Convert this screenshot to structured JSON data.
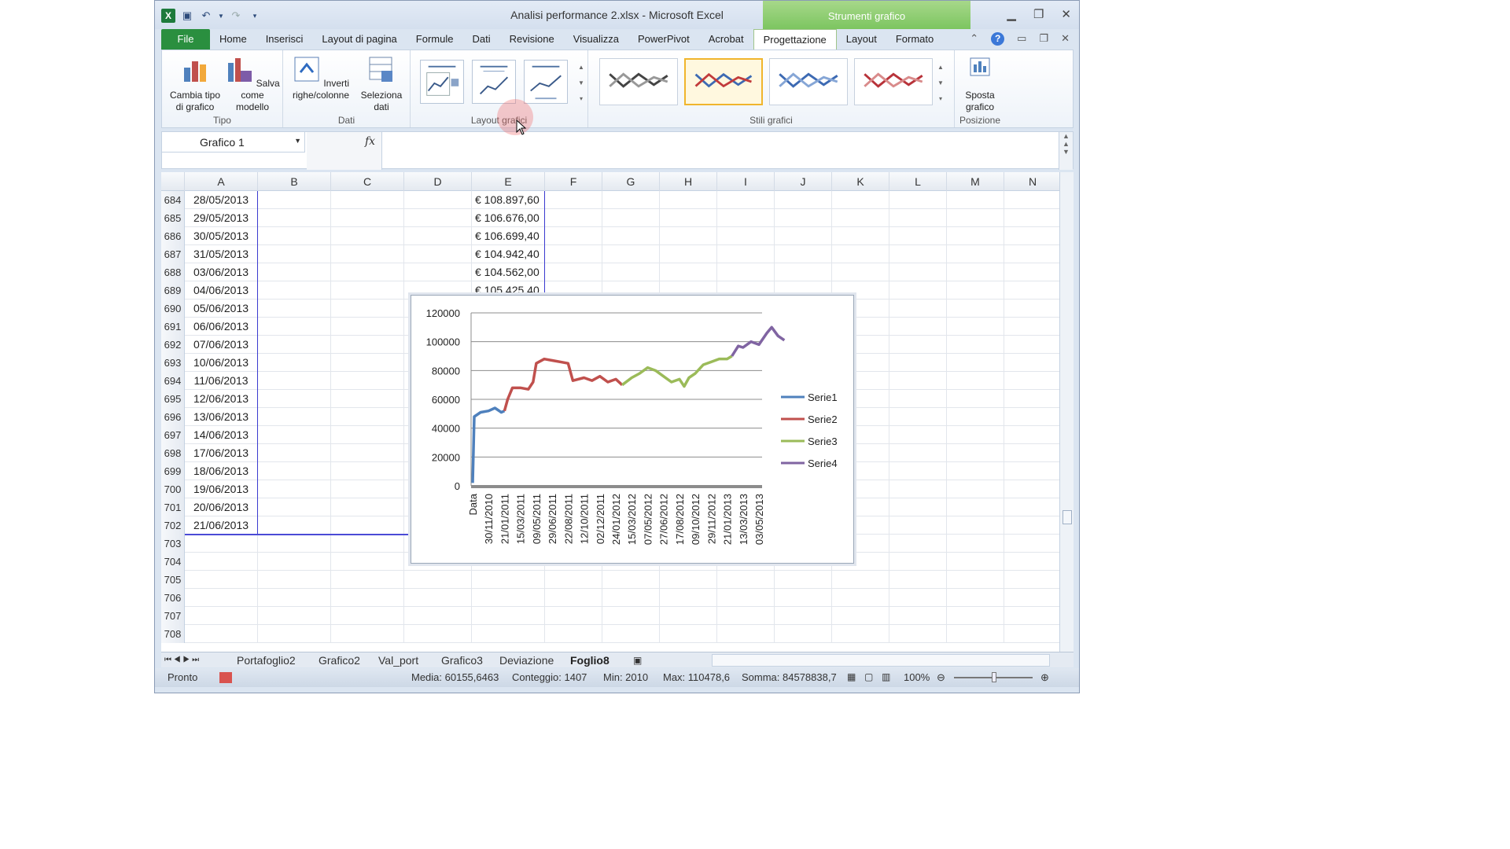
{
  "window": {
    "title": "Analisi performance 2.xlsx - Microsoft Excel",
    "contextual_title": "Strumenti grafico"
  },
  "menu": {
    "tabs": [
      "File",
      "Home",
      "Inserisci",
      "Layout di pagina",
      "Formule",
      "Dati",
      "Revisione",
      "Visualizza",
      "PowerPivot",
      "Acrobat",
      "Progettazione",
      "Layout",
      "Formato"
    ],
    "active": "Progettazione"
  },
  "ribbon": {
    "tipo": {
      "label": "Tipo",
      "change_type": "Cambia tipo di grafico",
      "save_template": "Salva come modello"
    },
    "dati": {
      "label": "Dati",
      "switch": "Inverti righe/colonne",
      "select": "Seleziona dati"
    },
    "layout_label": "Layout grafici",
    "styles_label": "Stili grafici",
    "posizione": {
      "label": "Posizione",
      "move": "Sposta grafico"
    }
  },
  "formula_bar": {
    "name_box": "Grafico 1",
    "fx": "fx"
  },
  "columns": [
    "A",
    "B",
    "C",
    "D",
    "E",
    "F",
    "G",
    "H",
    "I",
    "J",
    "K",
    "L",
    "M",
    "N"
  ],
  "rows": [
    {
      "n": "684",
      "a": "28/05/2013",
      "e": "€ 108.897,60"
    },
    {
      "n": "685",
      "a": "29/05/2013",
      "e": "€ 106.676,00"
    },
    {
      "n": "686",
      "a": "30/05/2013",
      "e": "€ 106.699,40"
    },
    {
      "n": "687",
      "a": "31/05/2013",
      "e": "€ 104.942,40"
    },
    {
      "n": "688",
      "a": "03/06/2013",
      "e": "€ 104.562,00"
    },
    {
      "n": "689",
      "a": "04/06/2013",
      "e": "€ 105.425,40"
    },
    {
      "n": "690",
      "a": "05/06/2013",
      "e": ""
    },
    {
      "n": "691",
      "a": "06/06/2013",
      "e": ""
    },
    {
      "n": "692",
      "a": "07/06/2013",
      "e": ""
    },
    {
      "n": "693",
      "a": "10/06/2013",
      "e": ""
    },
    {
      "n": "694",
      "a": "11/06/2013",
      "e": ""
    },
    {
      "n": "695",
      "a": "12/06/2013",
      "e": ""
    },
    {
      "n": "696",
      "a": "13/06/2013",
      "e": ""
    },
    {
      "n": "697",
      "a": "14/06/2013",
      "e": ""
    },
    {
      "n": "698",
      "a": "17/06/2013",
      "e": ""
    },
    {
      "n": "699",
      "a": "18/06/2013",
      "e": ""
    },
    {
      "n": "700",
      "a": "19/06/2013",
      "e": ""
    },
    {
      "n": "701",
      "a": "20/06/2013",
      "e": ""
    },
    {
      "n": "702",
      "a": "21/06/2013",
      "e": ""
    },
    {
      "n": "703",
      "a": "",
      "e": ""
    },
    {
      "n": "704",
      "a": "",
      "e": ""
    },
    {
      "n": "705",
      "a": "",
      "e": ""
    },
    {
      "n": "706",
      "a": "",
      "e": ""
    },
    {
      "n": "707",
      "a": "",
      "e": ""
    },
    {
      "n": "708",
      "a": "",
      "e": ""
    }
  ],
  "sheet_tabs": [
    "Portafoglio2",
    "Grafico2",
    "Val_port",
    "Grafico3",
    "Deviazione",
    "Foglio8"
  ],
  "active_sheet": "Foglio8",
  "status": {
    "ready": "Pronto",
    "media": "Media: 60155,6463",
    "conteggio": "Conteggio: 1407",
    "min": "Min: 2010",
    "max": "Max: 110478,6",
    "somma": "Somma: 84578838,7",
    "zoom": "100%"
  },
  "chart_data": {
    "type": "line",
    "ylim": [
      0,
      120000
    ],
    "yticks": [
      "0",
      "20000",
      "40000",
      "60000",
      "80000",
      "100000",
      "120000"
    ],
    "xticks": [
      "Data",
      "30/11/2010",
      "21/01/2011",
      "15/03/2011",
      "09/05/2011",
      "29/06/2011",
      "22/08/2011",
      "12/10/2011",
      "02/12/2011",
      "24/01/2012",
      "15/03/2012",
      "07/05/2012",
      "27/06/2012",
      "17/08/2012",
      "09/10/2012",
      "29/11/2012",
      "21/01/2013",
      "13/03/2013",
      "03/05/2013"
    ],
    "series": [
      {
        "name": "Serie1",
        "color": "#4f81bd",
        "points": [
          [
            0,
            2010
          ],
          [
            0.1,
            48000
          ],
          [
            0.5,
            51000
          ],
          [
            1,
            52000
          ],
          [
            1.4,
            54000
          ],
          [
            1.8,
            51000
          ],
          [
            2,
            52000
          ]
        ]
      },
      {
        "name": "Serie2",
        "color": "#c0504d",
        "points": [
          [
            2,
            52000
          ],
          [
            2.2,
            60000
          ],
          [
            2.5,
            68000
          ],
          [
            3,
            68000
          ],
          [
            3.5,
            67000
          ],
          [
            3.8,
            72000
          ],
          [
            4,
            85000
          ],
          [
            4.5,
            88000
          ],
          [
            5,
            87000
          ],
          [
            5.5,
            86000
          ],
          [
            6,
            85000
          ],
          [
            6.3,
            73000
          ],
          [
            7,
            75000
          ],
          [
            7.5,
            73000
          ],
          [
            8,
            76000
          ],
          [
            8.5,
            72000
          ],
          [
            9,
            74000
          ],
          [
            9.4,
            70000
          ]
        ]
      },
      {
        "name": "Serie3",
        "color": "#9bbb59",
        "points": [
          [
            9.4,
            70000
          ],
          [
            10,
            75000
          ],
          [
            10.5,
            78000
          ],
          [
            11,
            82000
          ],
          [
            11.5,
            80000
          ],
          [
            12,
            76000
          ],
          [
            12.5,
            72000
          ],
          [
            13,
            74000
          ],
          [
            13.3,
            69000
          ],
          [
            13.6,
            75000
          ],
          [
            14,
            78000
          ],
          [
            14.5,
            84000
          ],
          [
            15,
            86000
          ],
          [
            15.5,
            88000
          ],
          [
            16,
            88000
          ],
          [
            16.3,
            90000
          ]
        ]
      },
      {
        "name": "Serie4",
        "color": "#8064a2",
        "points": [
          [
            16.3,
            90000
          ],
          [
            16.7,
            97000
          ],
          [
            17,
            96000
          ],
          [
            17.5,
            100000
          ],
          [
            18,
            98000
          ],
          [
            18.5,
            106000
          ],
          [
            18.8,
            110000
          ],
          [
            19.2,
            104000
          ],
          [
            19.6,
            101000
          ]
        ]
      }
    ]
  }
}
